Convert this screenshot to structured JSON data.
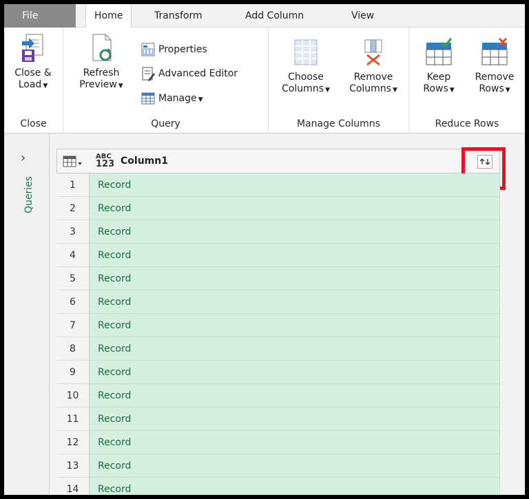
{
  "tabs": [
    "File",
    "Home",
    "Transform",
    "Add Column",
    "View"
  ],
  "ribbon": {
    "close_group": {
      "label": "Close",
      "button_line1": "Close &",
      "button_line2": "Load"
    },
    "query_group": {
      "label": "Query",
      "refresh_line1": "Refresh",
      "refresh_line2": "Preview",
      "properties": "Properties",
      "advanced_editor": "Advanced Editor",
      "manage": "Manage"
    },
    "manage_columns_group": {
      "label": "Manage Columns",
      "choose_line1": "Choose",
      "choose_line2": "Columns",
      "remove_line1": "Remove",
      "remove_line2": "Columns"
    },
    "reduce_rows_group": {
      "label": "Reduce Rows",
      "keep_line1": "Keep",
      "keep_line2": "Rows",
      "remove_line1": "Remove",
      "remove_line2": "Rows"
    }
  },
  "query_pane": {
    "chevron": "›",
    "label": "Queries"
  },
  "grid": {
    "type_icon_top": "ABC",
    "type_icon_bottom": "123",
    "column_name": "Column1",
    "rows": [
      {
        "n": "1",
        "v": "Record"
      },
      {
        "n": "2",
        "v": "Record"
      },
      {
        "n": "3",
        "v": "Record"
      },
      {
        "n": "4",
        "v": "Record"
      },
      {
        "n": "5",
        "v": "Record"
      },
      {
        "n": "6",
        "v": "Record"
      },
      {
        "n": "7",
        "v": "Record"
      },
      {
        "n": "8",
        "v": "Record"
      },
      {
        "n": "9",
        "v": "Record"
      },
      {
        "n": "10",
        "v": "Record"
      },
      {
        "n": "11",
        "v": "Record"
      },
      {
        "n": "12",
        "v": "Record"
      },
      {
        "n": "13",
        "v": "Record"
      },
      {
        "n": "14",
        "v": "Record"
      }
    ]
  },
  "colors": {
    "highlight": "#e81123",
    "cell_bg": "#d6efe1",
    "accent_green": "#1d7a4f"
  }
}
